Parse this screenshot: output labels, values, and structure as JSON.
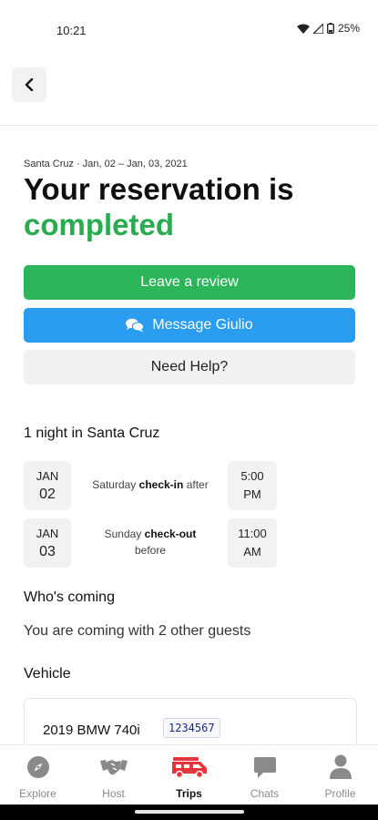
{
  "status_bar": {
    "time": "10:21",
    "battery": "25%"
  },
  "reservation": {
    "meta": "Santa Cruz · Jan, 02 – Jan, 03, 2021",
    "heading": "Your reservation is",
    "status": "completed"
  },
  "actions": {
    "review_label": "Leave a review",
    "message_label": "Message Giulio",
    "help_label": "Need Help?"
  },
  "stay": {
    "title": "1 night in Santa Cruz",
    "checkin": {
      "month": "JAN",
      "day": "02",
      "weekday": "Saturday",
      "label": "check-in",
      "suffix": "after",
      "time": "5:00",
      "ampm": "PM"
    },
    "checkout": {
      "month": "JAN",
      "day": "03",
      "weekday": "Sunday",
      "label": "check-out",
      "suffix": "before",
      "time": "11:00",
      "ampm": "AM"
    }
  },
  "guests": {
    "title": "Who's coming",
    "text": "You are coming with 2 other guests"
  },
  "vehicle": {
    "title": "Vehicle",
    "name": "2019 BMW 740i",
    "plate": "1234567"
  },
  "nav": {
    "items": [
      {
        "label": "Explore",
        "icon": "compass-icon"
      },
      {
        "label": "Host",
        "icon": "handshake-icon"
      },
      {
        "label": "Trips",
        "icon": "rv-icon",
        "active": true
      },
      {
        "label": "Chats",
        "icon": "chat-bubble-icon"
      },
      {
        "label": "Profile",
        "icon": "person-icon"
      }
    ]
  },
  "colors": {
    "accent_green": "#2db55a",
    "status_green": "#28ac4f",
    "message_blue": "#2a9df0",
    "trips_red": "#e8333c"
  }
}
